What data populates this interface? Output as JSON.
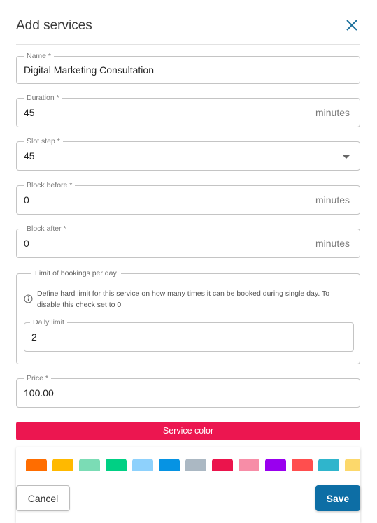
{
  "dialog": {
    "title": "Add services",
    "close_icon": "close-icon"
  },
  "fields": {
    "name": {
      "label": "Name *",
      "value": "Digital Marketing Consultation"
    },
    "duration": {
      "label": "Duration *",
      "value": "45",
      "suffix": "minutes"
    },
    "slot_step": {
      "label": "Slot step *",
      "value": "45",
      "icon": "dropdown-caret-icon"
    },
    "block_before": {
      "label": "Block before *",
      "value": "0",
      "suffix": "minutes"
    },
    "block_after": {
      "label": "Block after *",
      "value": "0",
      "suffix": "minutes"
    },
    "price": {
      "label": "Price *",
      "value": "100.00"
    }
  },
  "limit_group": {
    "legend": "Limit of bookings per day",
    "info_icon": "info-icon",
    "help_text": "Define hard limit for this service on how many times it can be booked during single day. To disable this check set to 0",
    "daily_limit": {
      "label": "Daily limit",
      "value": "2"
    }
  },
  "service_color": {
    "label": "Service color",
    "color": "#ec1650",
    "swatches": [
      "#ff6d00",
      "#ffb900",
      "#7bdcb5",
      "#00d084",
      "#8ed1fc",
      "#0693e3",
      "#abb8c3",
      "#eb144c",
      "#f78da7",
      "#9900ef",
      "#ff4e4e",
      "#2fb5cc",
      "#fcd86b"
    ]
  },
  "actions": {
    "cancel_label": "Cancel",
    "save_label": "Save",
    "save_color": "#0d6ea5"
  }
}
